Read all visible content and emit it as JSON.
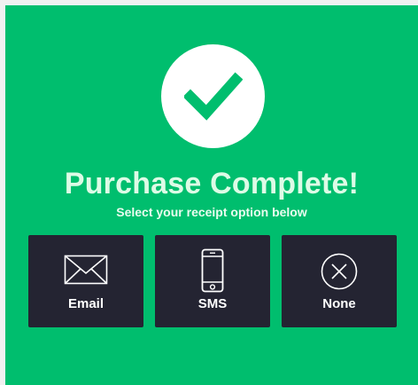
{
  "success": {
    "icon": "checkmark-icon",
    "title": "Purchase Complete!",
    "subtitle": "Select your receipt option below"
  },
  "receipt_options": [
    {
      "label": "Email",
      "icon": "envelope-icon"
    },
    {
      "label": "SMS",
      "icon": "mobile-phone-icon"
    },
    {
      "label": "None",
      "icon": "close-circle-icon"
    }
  ],
  "colors": {
    "background": "#00be6e",
    "button": "#242432",
    "title": "#ddfbe6",
    "white": "#ffffff"
  }
}
